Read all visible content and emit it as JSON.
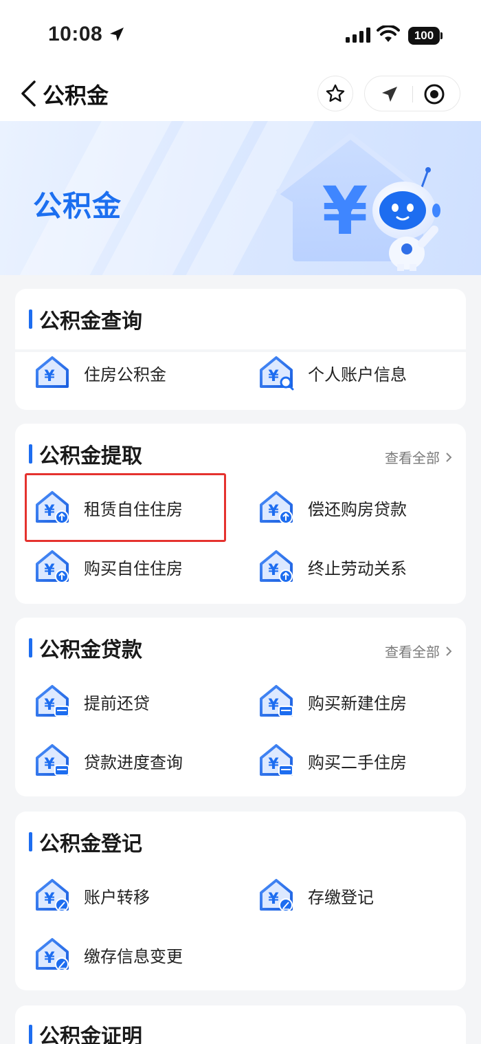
{
  "status_bar": {
    "time": "10:08",
    "battery": "100"
  },
  "nav": {
    "title": "公积金"
  },
  "banner": {
    "title": "公积金"
  },
  "colors": {
    "accent": "#1d6df0",
    "highlight": "#e5322e"
  },
  "sections": {
    "query": {
      "title": "公积金查询",
      "items": [
        "住房公积金",
        "个人账户信息"
      ]
    },
    "withdraw": {
      "title": "公积金提取",
      "see_all": "查看全部",
      "items": [
        "租赁自住住房",
        "偿还购房贷款",
        "购买自住住房",
        "终止劳动关系"
      ]
    },
    "loan": {
      "title": "公积金贷款",
      "see_all": "查看全部",
      "items": [
        "提前还贷",
        "购买新建住房",
        "贷款进度查询",
        "购买二手住房"
      ]
    },
    "register": {
      "title": "公积金登记",
      "items": [
        "账户转移",
        "存缴登记",
        "缴存信息变更"
      ]
    },
    "certificate": {
      "title": "公积金证明"
    }
  },
  "icons": {
    "query": [
      "house-yen-icon",
      "house-yen-search-icon"
    ],
    "withdraw": "house-yen-up-icon",
    "loan": "house-yen-card-icon",
    "register": "house-yen-edit-icon"
  }
}
